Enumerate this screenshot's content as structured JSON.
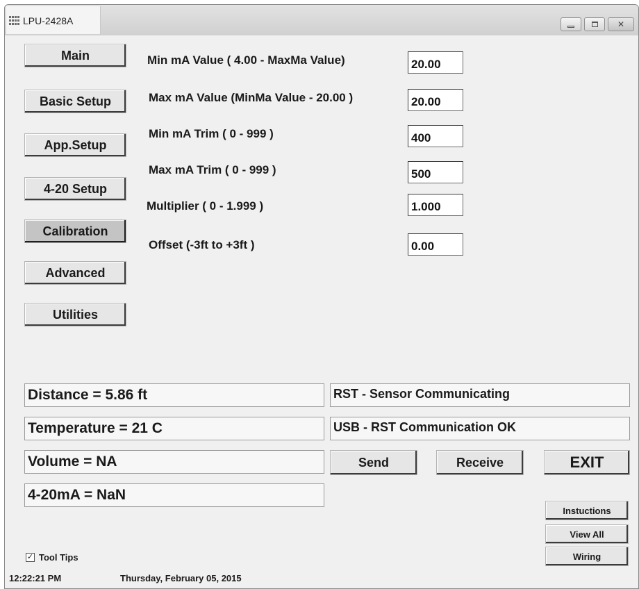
{
  "window": {
    "title": "LPU-2428A"
  },
  "nav": {
    "main": "Main",
    "basic_setup": "Basic Setup",
    "app_setup": "App.Setup",
    "setup_4_20": "4-20 Setup",
    "calibration": "Calibration",
    "advanced": "Advanced",
    "utilities": "Utilities",
    "active": "Calibration"
  },
  "fields": {
    "min_ma_value": {
      "label": "Min mA Value ( 4.00 - MaxMa Value)",
      "value": "20.00"
    },
    "max_ma_value": {
      "label": "Max mA Value (MinMa Value - 20.00 )",
      "value": "20.00"
    },
    "min_ma_trim": {
      "label": "Min mA Trim ( 0 - 999 )",
      "value": "400"
    },
    "max_ma_trim": {
      "label": "Max mA Trim ( 0 - 999 )",
      "value": "500"
    },
    "multiplier": {
      "label": "Multiplier ( 0 - 1.999 )",
      "value": "1.000"
    },
    "offset": {
      "label": "Offset (-3ft to +3ft )",
      "value": "0.00"
    }
  },
  "readings": {
    "distance": "Distance = 5.86 ft",
    "temperature": "Temperature = 21 C",
    "volume": "Volume = NA",
    "current": "4-20mA = NaN"
  },
  "status": {
    "sensor": "RST - Sensor Communicating",
    "usb": "USB - RST Communication OK"
  },
  "actions": {
    "send": "Send",
    "receive": "Receive",
    "exit": "EXIT",
    "instructions": "Instuctions",
    "view_all": "View All",
    "wiring": "Wiring"
  },
  "footer": {
    "tool_tips_label": "Tool Tips",
    "tool_tips_checked": true,
    "time": "12:22:21 PM",
    "date": "Thursday, February 05, 2015"
  }
}
